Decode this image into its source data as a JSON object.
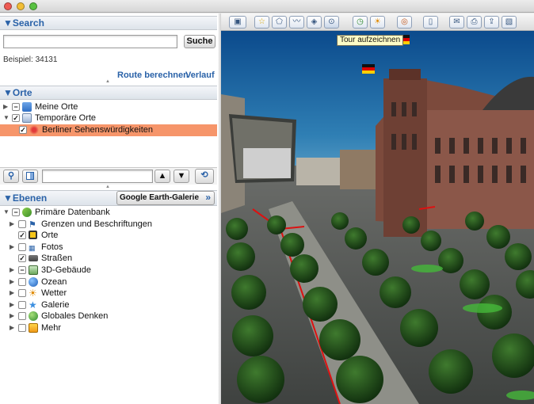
{
  "window": {
    "colors": {
      "close": "#ee5a52",
      "minimize": "#f2be36",
      "zoom": "#58c141"
    }
  },
  "search": {
    "header": "▼Search",
    "input_value": "",
    "button_label": "Suche",
    "example": "Beispiel: 34131",
    "links": {
      "route": "Route berechnen",
      "history": "Verlauf"
    }
  },
  "places": {
    "header": "▼Orte",
    "items": [
      {
        "label": "Meine Orte",
        "expanded": false,
        "checked": "partial",
        "icon": "folder-icon"
      },
      {
        "label": "Temporäre Orte",
        "expanded": true,
        "checked": "checked",
        "icon": "folder-icon"
      },
      {
        "label": "Berliner Sehenswürdigkeiten",
        "checked": "checked",
        "icon": "tour-icon",
        "selected": true
      }
    ]
  },
  "places_footer": {
    "search_value": ""
  },
  "layers": {
    "header": "▼Ebenen",
    "gallery_button": "Google Earth-Galerie",
    "gallery_chevron": "»",
    "root": {
      "label": "Primäre Datenbank",
      "checked": "partial"
    },
    "items": [
      {
        "label": "Grenzen und Beschriftungen",
        "checked": "none",
        "icon": "flag-icon",
        "has_children": true
      },
      {
        "label": "Orte",
        "checked": "checked",
        "icon": "place-icon",
        "has_children": false
      },
      {
        "label": "Fotos",
        "checked": "none",
        "icon": "photo-icon",
        "has_children": true
      },
      {
        "label": "Straßen",
        "checked": "checked",
        "icon": "road-icon",
        "has_children": false
      },
      {
        "label": "3D-Gebäude",
        "checked": "partial",
        "icon": "building-icon",
        "has_children": true
      },
      {
        "label": "Ozean",
        "checked": "none",
        "icon": "ocean-icon",
        "has_children": true
      },
      {
        "label": "Wetter",
        "checked": "none",
        "icon": "weather-icon",
        "has_children": true
      },
      {
        "label": "Galerie",
        "checked": "none",
        "icon": "gallery-icon",
        "has_children": true
      },
      {
        "label": "Globales Denken",
        "checked": "none",
        "icon": "globe-icon",
        "has_children": true
      },
      {
        "label": "Mehr",
        "checked": "none",
        "icon": "more-icon",
        "has_children": true
      }
    ]
  },
  "toolbar": {
    "tooltip": "Tour aufzeichnen",
    "buttons": [
      "sidebar-icon",
      "placemark-icon",
      "polygon-icon",
      "path-icon",
      "overlay-icon",
      "record-tour-icon",
      "historical-imagery-icon",
      "sunlight-icon",
      "planets-icon",
      "ruler-icon",
      "email-icon",
      "print-icon",
      "save-image-icon",
      "maps-icon"
    ]
  }
}
